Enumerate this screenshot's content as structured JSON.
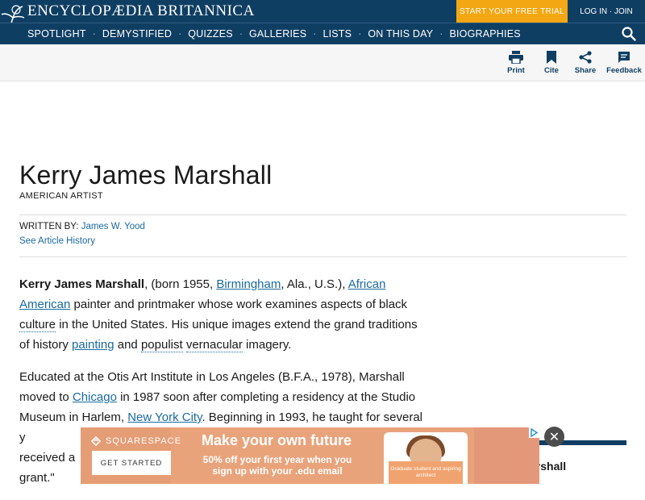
{
  "header": {
    "brand": "ENCYCLOPÆDIA BRITANNICA",
    "trial_label": "START YOUR FREE TRIAL",
    "login_label": "LOG IN · JOIN",
    "nav": [
      "SPOTLIGHT",
      "DEMYSTIFIED",
      "QUIZZES",
      "GALLERIES",
      "LISTS",
      "ON THIS DAY",
      "BIOGRAPHIES"
    ],
    "colors": {
      "navy": "#0f3e63",
      "trial": "#f3a712",
      "link": "#1a6aa0"
    }
  },
  "toolbar": {
    "print": "Print",
    "cite": "Cite",
    "share": "Share",
    "feedback": "Feedback"
  },
  "article": {
    "title": "Kerry James Marshall",
    "subtitle": "AMERICAN ARTIST",
    "written_by_label": "WRITTEN BY:",
    "author": "James W. Yood",
    "history_link": "See Article History",
    "p1": {
      "name": "Kerry James Marshall",
      "t1": ", (born 1955, ",
      "l1": "Birmingham",
      "t2": ", Ala., U.S.), ",
      "l2": "African American",
      "t3": " painter and printmaker whose work examines aspects of black ",
      "l3": "culture",
      "t4": " in the United States. His unique images extend the grand traditions of history ",
      "l4": "painting",
      "t5": " and ",
      "l5": "populist",
      "t6": " ",
      "l6": "vernacular",
      "t7": " imagery."
    },
    "p2": {
      "t1": "Educated at the Otis Art Institute in Los Angeles (B.F.A., 1978), Marshall moved to ",
      "l1": "Chicago",
      "t2": " in 1987 soon after completing a residency at the Studio Museum in Harlem, ",
      "l2": "New York City",
      "t3": ". Beginning in 1993, he taught for several y",
      "t4": "received a ",
      "t5": "grant.\""
    }
  },
  "sidebar_box": {
    "label": "arshall"
  },
  "ad": {
    "brand": "SQUARESPACE",
    "button": "GET STARTED",
    "headline": "Make your own future",
    "line1": "50% off your first year when you",
    "line2": "sign up with your .edu email",
    "phone_caption": "Graduate student and aspiring architect"
  },
  "close_icon_label": "✕"
}
